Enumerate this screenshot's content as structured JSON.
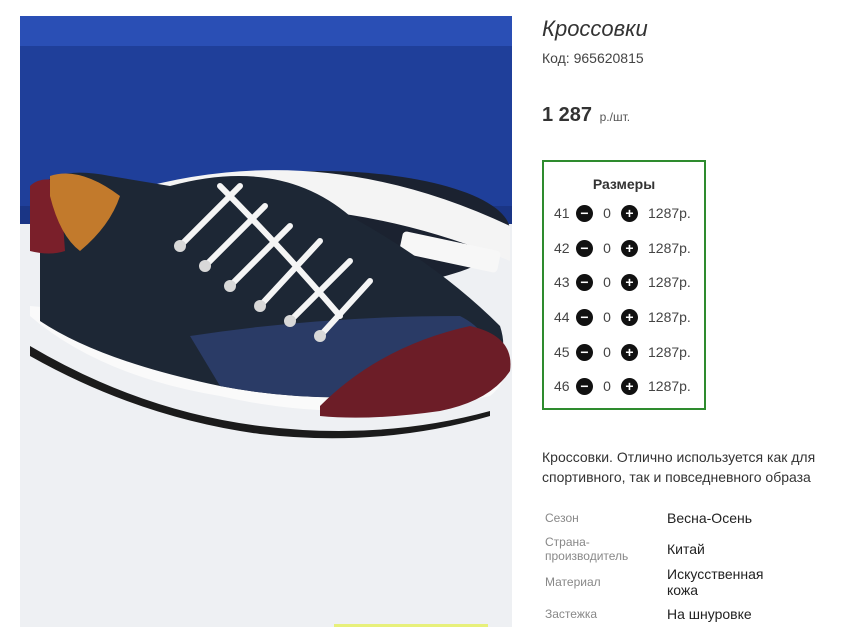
{
  "product": {
    "title": "Кроссовки",
    "code": "Код: 965620815",
    "price": "1 287",
    "price_unit": "р./шт.",
    "image_alt": "shoe-photo"
  },
  "sizes": {
    "title": "Размеры",
    "rows": [
      {
        "size": "41",
        "qty": "0",
        "price": "1287р."
      },
      {
        "size": "42",
        "qty": "0",
        "price": "1287р."
      },
      {
        "size": "43",
        "qty": "0",
        "price": "1287р."
      },
      {
        "size": "44",
        "qty": "0",
        "price": "1287р."
      },
      {
        "size": "45",
        "qty": "0",
        "price": "1287р."
      },
      {
        "size": "46",
        "qty": "0",
        "price": "1287р."
      }
    ],
    "minus_symbol": "−",
    "plus_symbol": "+"
  },
  "description": {
    "line1": "Кроссовки. Отлично используется как для",
    "line2": "спортивного, так и повседневного образа"
  },
  "properties": [
    {
      "key": "Сезон",
      "value": "Весна-Осень"
    },
    {
      "key": "Страна-производитель",
      "value": "Китай"
    },
    {
      "key": "Материал",
      "value": "Искусственная кожа"
    },
    {
      "key": "Застежка",
      "value": "На шнуровке"
    }
  ],
  "colors": {
    "accent_border": "#2e8b2e",
    "button": "#111111"
  }
}
